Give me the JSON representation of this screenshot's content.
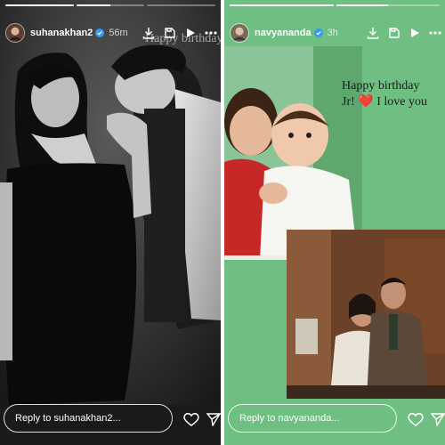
{
  "stories": [
    {
      "username": "suhanakhan2",
      "time": "56m",
      "overlay_text": "Happy birthday",
      "reply_placeholder": "Reply to suhanakhan2...",
      "progress": [
        1,
        0.5,
        0
      ]
    },
    {
      "username": "navyananda",
      "time": "3h",
      "bday_line1": "Happy birthday",
      "bday_line2_prefix": "Jr!",
      "bday_heart": "❤️",
      "bday_line2_suffix": "I love you",
      "reply_placeholder": "Reply to navyananda...",
      "progress": [
        1,
        0.5
      ]
    }
  ],
  "icons": [
    "verified-badge-icon",
    "download-icon",
    "save-icon",
    "play-icon",
    "more-icon",
    "heart-icon",
    "send-icon"
  ],
  "colors": {
    "left_bg": "#121212",
    "right_bg": "#6fbf82",
    "verified": "#3897f0",
    "heart": "#d62020"
  }
}
